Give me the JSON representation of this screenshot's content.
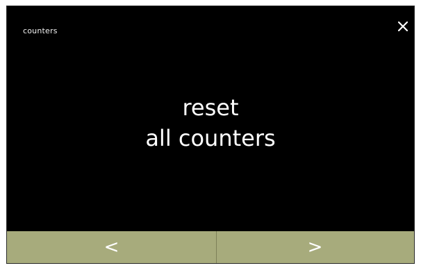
{
  "header": {
    "title": "counters",
    "close_icon": "close-icon"
  },
  "message": {
    "line1": "reset",
    "line2": "all counters"
  },
  "nav": {
    "prev_glyph": "<",
    "next_glyph": ">",
    "prev_icon": "chevron-left-icon",
    "next_icon": "chevron-right-icon"
  },
  "colors": {
    "screen_background": "#000000",
    "text": "#ffffff",
    "nav_bar": "#a7ab7c"
  }
}
